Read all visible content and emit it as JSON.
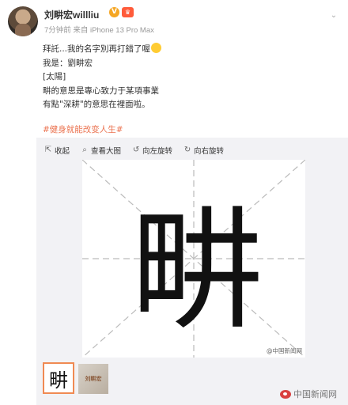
{
  "user": {
    "name": "刘畊宏willliu",
    "verified_badge": "V",
    "level_badge": "♛",
    "meta": "7分钟前 来自 iPhone 13 Pro Max"
  },
  "post": {
    "lines": [
      "拜託...我的名字別再打錯了喔",
      "我是：劉畊宏",
      "[太陽]",
      "畊的意思是專心致力于某項事業",
      "有點\"深耕\"的意思在裡面啦。"
    ],
    "hashtag": "#健身就能改变人生#"
  },
  "toolbar": {
    "collect": "收起",
    "view_large": "查看大图",
    "rotate_left": "向左旋转",
    "rotate_right": "向右旋转"
  },
  "image": {
    "character": "畊",
    "small_watermark": "@中国新闻网"
  },
  "thumbnails": {
    "first": "畊",
    "second": "刘畊宏"
  },
  "watermark": "中国新闻网",
  "colors": {
    "accent": "#eb7350",
    "thumb_border": "#f08a53",
    "guide_lines": "#bbbbbb"
  }
}
